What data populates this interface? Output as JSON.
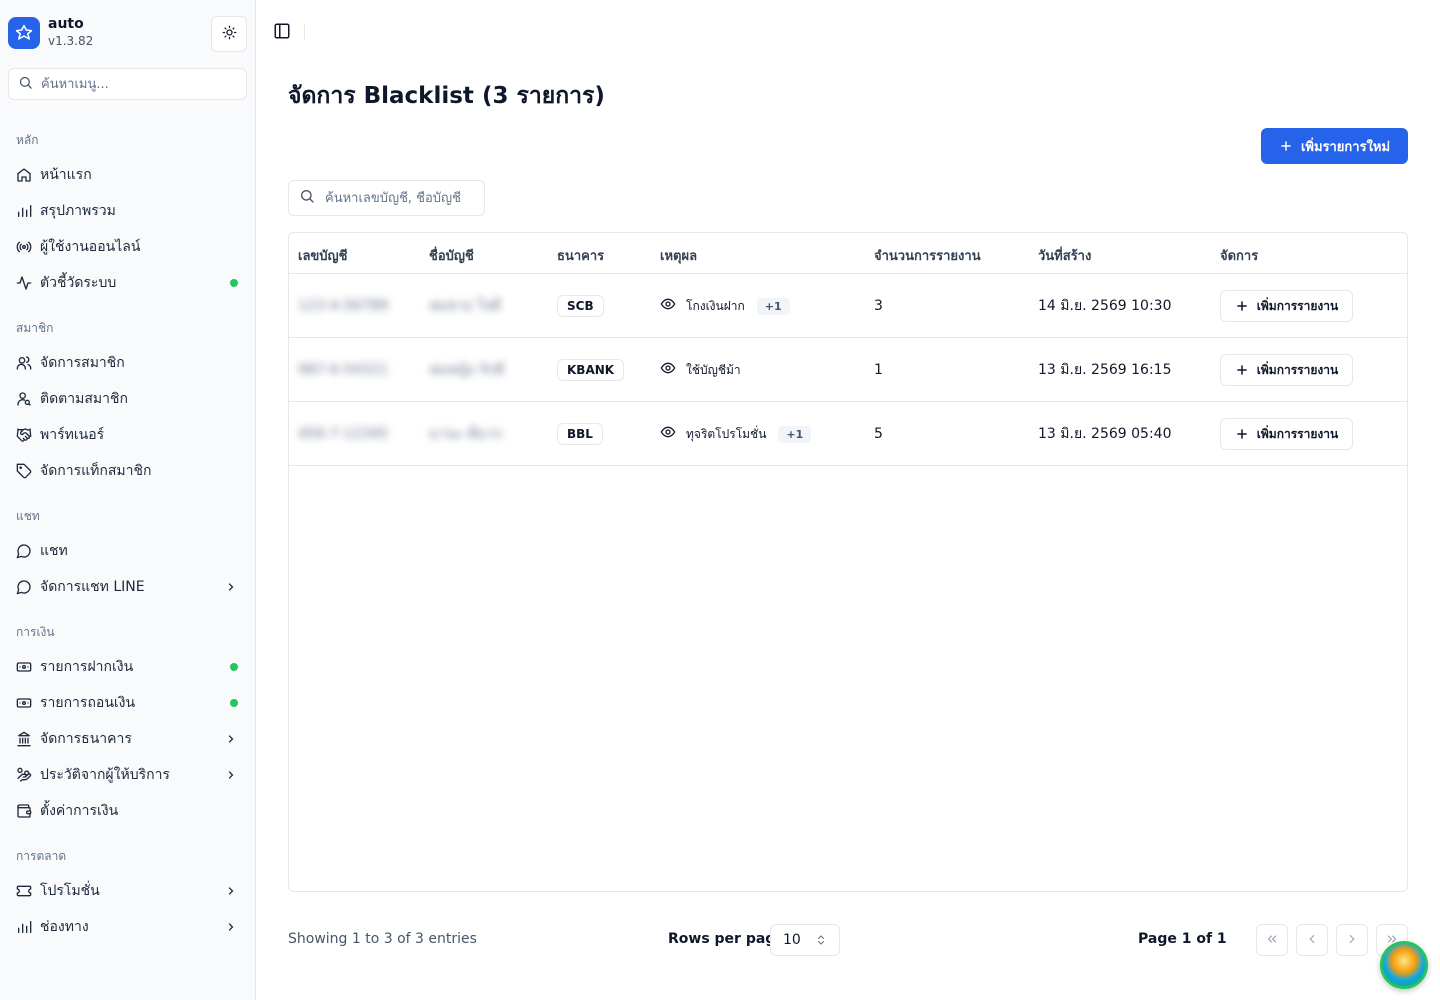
{
  "app": {
    "name": "auto",
    "version": "v1.3.82"
  },
  "sidebar": {
    "search_placeholder": "ค้นหาเมนู...",
    "groups": [
      {
        "label": "หลัก"
      },
      {
        "label": "สมาชิก"
      },
      {
        "label": "แชท"
      },
      {
        "label": "การเงิน"
      },
      {
        "label": "การตลาด"
      }
    ],
    "items": [
      {
        "label": "หน้าแรก",
        "icon": "home-icon"
      },
      {
        "label": "สรุปภาพรวม",
        "icon": "bar-chart-icon"
      },
      {
        "label": "ผู้ใช้งานออนไลน์",
        "icon": "radio-icon"
      },
      {
        "label": "ตัวชี้วัดระบบ",
        "icon": "activity-icon",
        "status_dot": true
      },
      {
        "label": "จัดการสมาชิก",
        "icon": "users-icon"
      },
      {
        "label": "ติดตามสมาชิก",
        "icon": "user-search-icon"
      },
      {
        "label": "พาร์ทเนอร์",
        "icon": "handshake-icon"
      },
      {
        "label": "จัดการแท็กสมาชิก",
        "icon": "tag-icon"
      },
      {
        "label": "แชท",
        "icon": "message-circle-icon"
      },
      {
        "label": "จัดการแชท LINE",
        "icon": "message-circle-icon",
        "chevron": true
      },
      {
        "label": "รายการฝากเงิน",
        "icon": "deposit-icon",
        "status_dot": true
      },
      {
        "label": "รายการถอนเงิน",
        "icon": "withdraw-icon",
        "status_dot": true
      },
      {
        "label": "จัดการธนาคาร",
        "icon": "landmark-icon",
        "chevron": true
      },
      {
        "label": "ประวัติจากผู้ให้บริการ",
        "icon": "hand-coins-icon",
        "chevron": true
      },
      {
        "label": "ตั้งค่าการเงิน",
        "icon": "wallet-icon"
      },
      {
        "label": "โปรโมชั่น",
        "icon": "ticket-icon",
        "chevron": true
      },
      {
        "label": "ช่องทาง",
        "icon": "bar-chart-icon",
        "chevron": true
      }
    ],
    "status_color": "#22c55e"
  },
  "main": {
    "title": "จัดการ Blacklist (3 รายการ)",
    "add_button": "เพิ่มรายการใหม่",
    "search_placeholder": "ค้นหาเลขบัญชี, ชื่อบัญชี",
    "accent": "#2563eb"
  },
  "table": {
    "columns": [
      "เลขบัญชี",
      "ชื่อบัญชี",
      "ธนาคาร",
      "เหตุผล",
      "จำนวนการรายงาน",
      "วันที่สร้าง",
      "จัดการ"
    ],
    "rows": [
      {
        "account_no": "123-4-56789",
        "account_name": "สมชาย ใจดี",
        "bank": "SCB",
        "reason": "โกงเงินฝาก",
        "more": "+1",
        "reports": "3",
        "created": "14 มิ.ย. 2569 10:30",
        "action": "เพิ่มการรายงาน"
      },
      {
        "account_no": "987-6-54321",
        "account_name": "สมหญิง รักดี",
        "bank": "KBANK",
        "reason": "ใช้บัญชีม้า",
        "more": "",
        "reports": "1",
        "created": "13 มิ.ย. 2569 16:15",
        "action": "เพิ่มการรายงาน"
      },
      {
        "account_no": "456-7-12345",
        "account_name": "มานะ ดีมาก",
        "bank": "BBL",
        "reason": "ทุจริตโปรโมชั่น",
        "more": "+1",
        "reports": "5",
        "created": "13 มิ.ย. 2569 05:40",
        "action": "เพิ่มการรายงาน"
      }
    ]
  },
  "pagination": {
    "info": "Showing 1 to 3 of 3 entries",
    "rows_per_page_label": "Rows per page",
    "rows_per_page": "10",
    "page_info": "Page 1 of 1"
  }
}
